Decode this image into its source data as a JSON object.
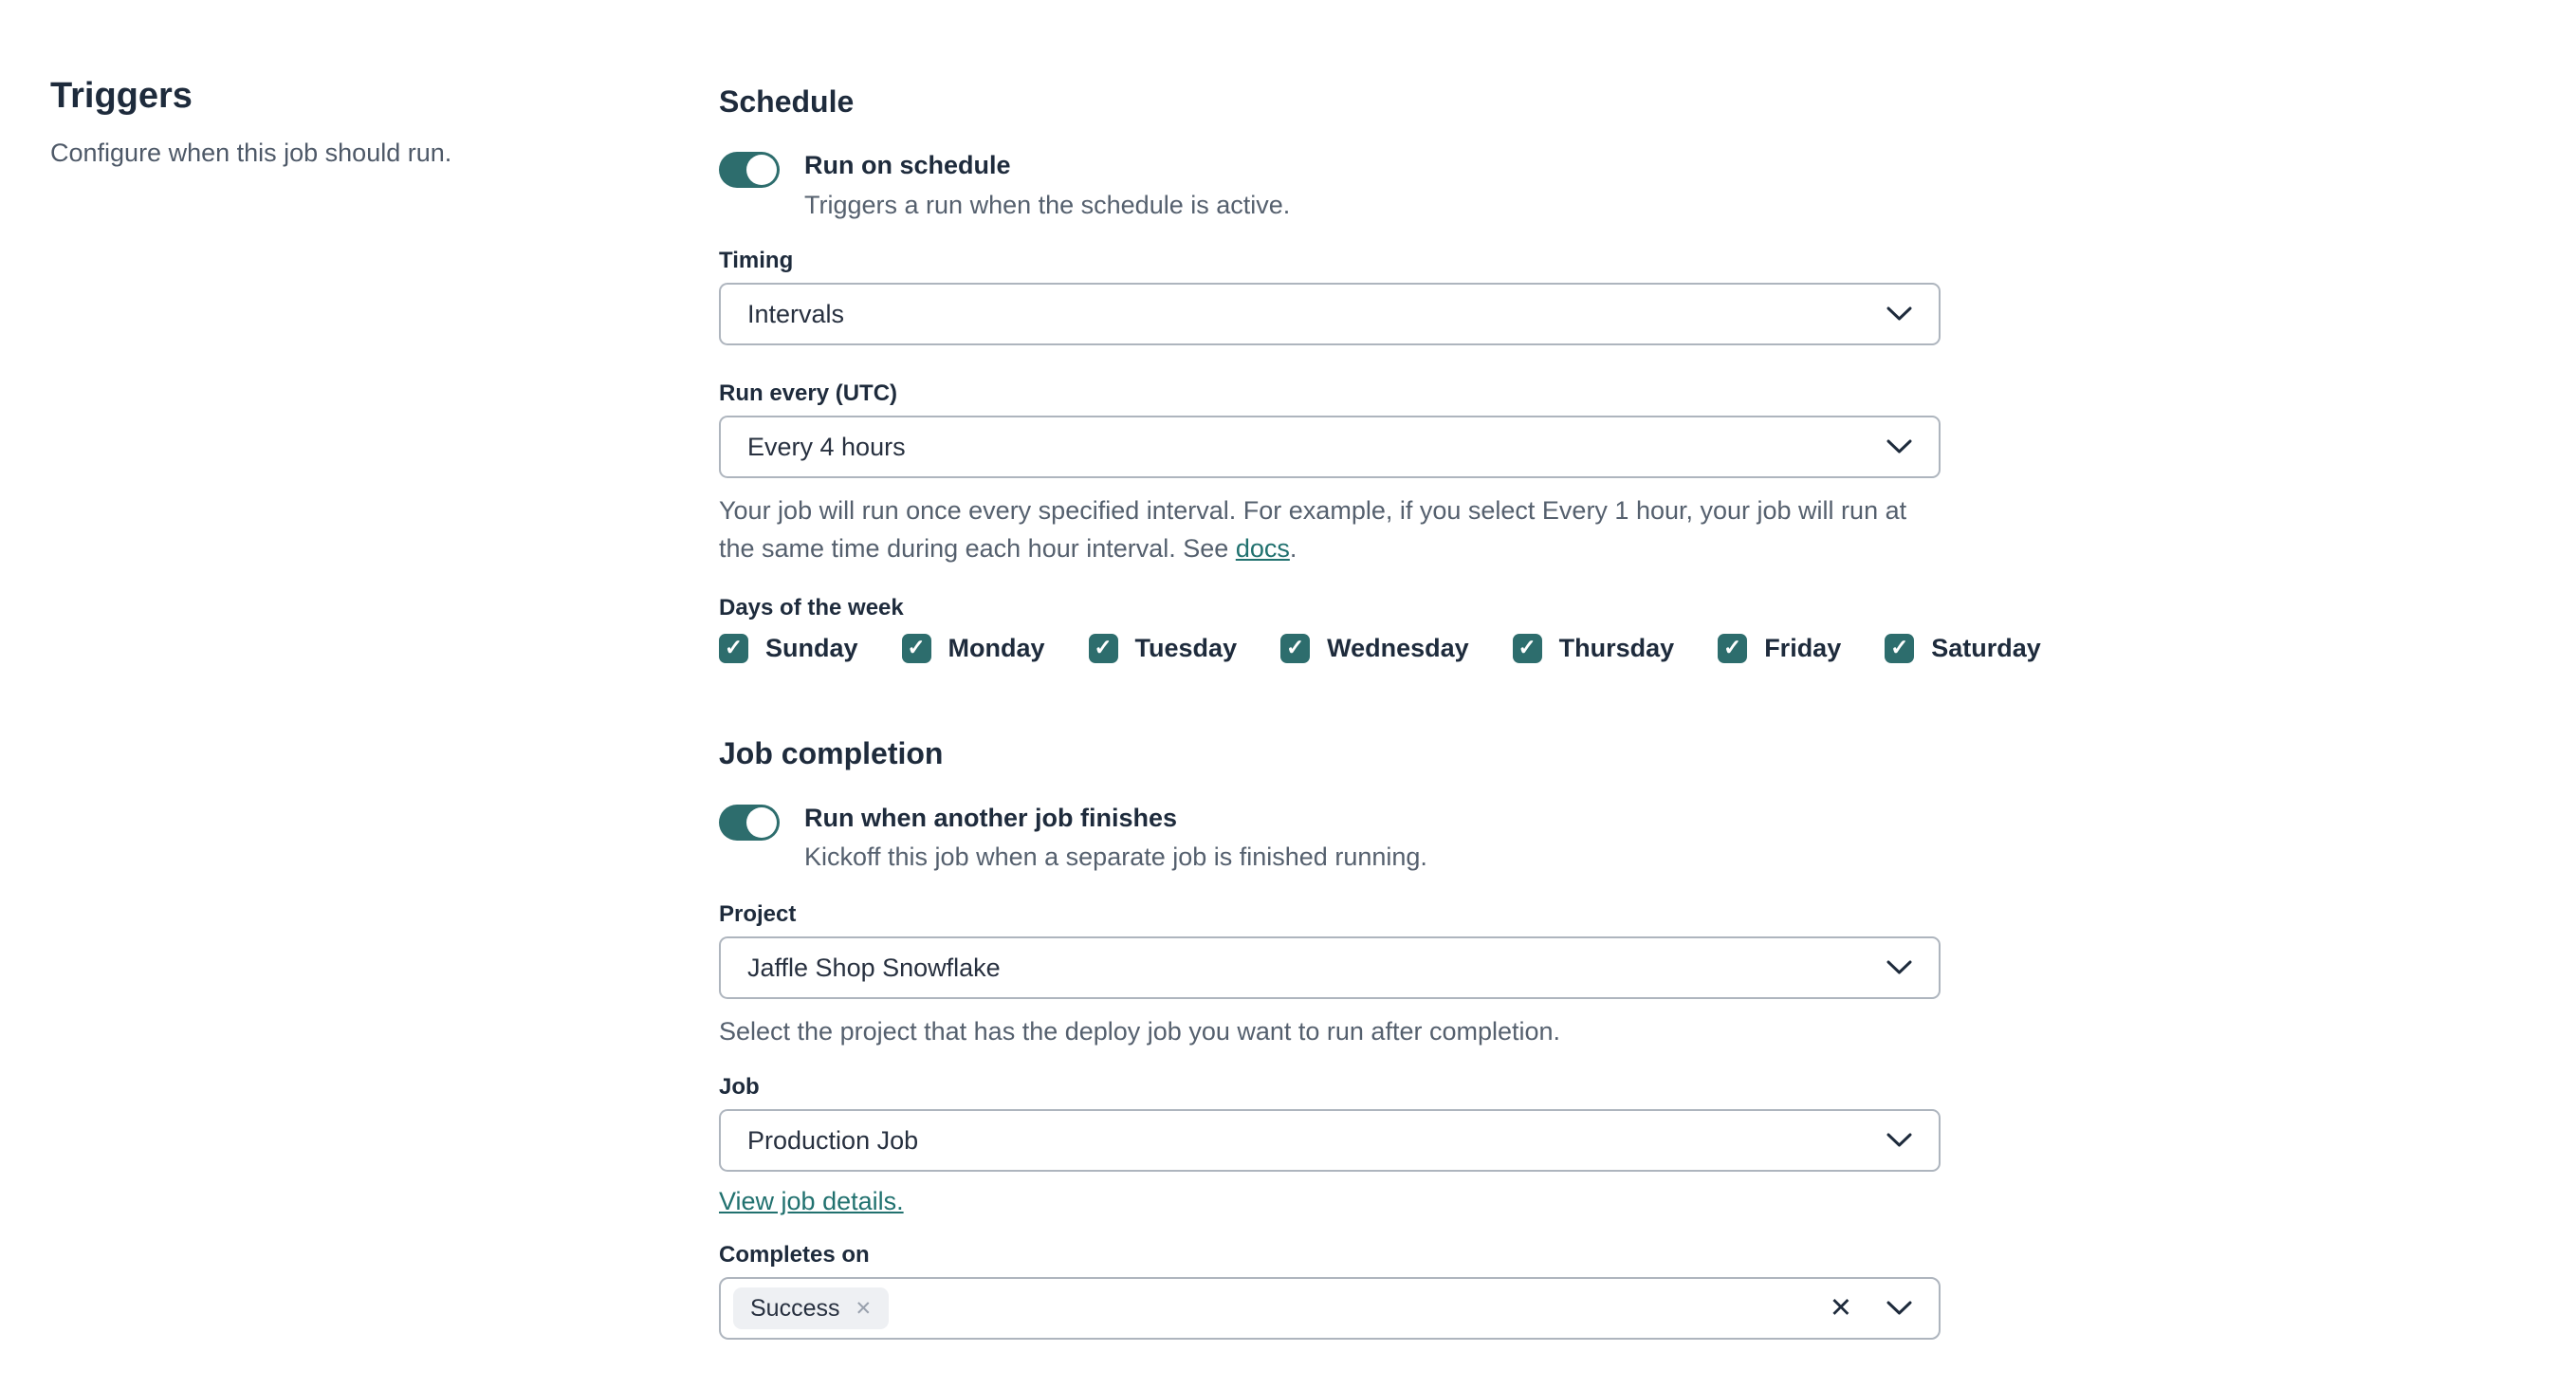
{
  "sidebar": {
    "title": "Triggers",
    "subtitle": "Configure when this job should run."
  },
  "schedule": {
    "heading": "Schedule",
    "run_on_schedule": {
      "label": "Run on schedule",
      "description": "Triggers a run when the schedule is active.",
      "enabled": true
    },
    "timing": {
      "label": "Timing",
      "value": "Intervals"
    },
    "run_every": {
      "label": "Run every (UTC)",
      "value": "Every 4 hours",
      "help_text": "Your job will run once every specified interval. For example, if you select Every 1 hour, your job will run at the same time during each hour interval. See ",
      "help_link_label": "docs",
      "help_after_link": "."
    },
    "days": {
      "label": "Days of the week",
      "items": [
        {
          "label": "Sunday",
          "checked": true
        },
        {
          "label": "Monday",
          "checked": true
        },
        {
          "label": "Tuesday",
          "checked": true
        },
        {
          "label": "Wednesday",
          "checked": true
        },
        {
          "label": "Thursday",
          "checked": true
        },
        {
          "label": "Friday",
          "checked": true
        },
        {
          "label": "Saturday",
          "checked": true
        }
      ]
    }
  },
  "job_completion": {
    "heading": "Job completion",
    "run_when_finishes": {
      "label": "Run when another job finishes",
      "description": "Kickoff this job when a separate job is finished running.",
      "enabled": true
    },
    "project": {
      "label": "Project",
      "value": "Jaffle Shop Snowflake",
      "help_text": "Select the project that has the deploy job you want to run after completion."
    },
    "job": {
      "label": "Job",
      "value": "Production Job",
      "link_label": "View job details."
    },
    "completes_on": {
      "label": "Completes on",
      "selected": [
        {
          "label": "Success"
        }
      ]
    }
  },
  "icons": {
    "check": "✓",
    "chip_close": "✕",
    "clear": "✕"
  },
  "colors": {
    "accent_teal": "#2d6d6d",
    "text_dark": "#1e2b3c",
    "text_muted": "#55606e",
    "link_teal": "#21716f",
    "border": "#aeb5be",
    "chip_bg": "#eef0f3"
  }
}
